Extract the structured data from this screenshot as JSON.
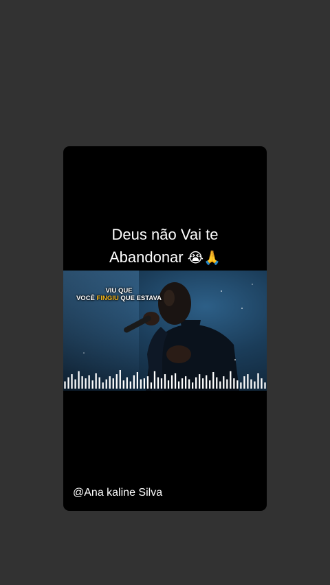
{
  "post": {
    "title_line1": "Deus não Vai te",
    "title_line2": "Abandonar",
    "title_emojis": "😭🙏",
    "caption_line1": "VIU QUE",
    "caption_pre": "VOCÊ ",
    "caption_highlight": "FINGIU",
    "caption_post": " QUE ESTAVA",
    "author_handle": "@Ana kaline Silva"
  },
  "colors": {
    "background": "#323232",
    "card": "#000000",
    "caption_highlight": "#f2b51b"
  },
  "waveform_levels": [
    0.35,
    0.55,
    0.7,
    0.45,
    0.85,
    0.6,
    0.5,
    0.65,
    0.4,
    0.75,
    0.55,
    0.3,
    0.45,
    0.6,
    0.5,
    0.7,
    0.9,
    0.4,
    0.55,
    0.35,
    0.65,
    0.8,
    0.45,
    0.5,
    0.6,
    0.3,
    0.85,
    0.55,
    0.5,
    0.7,
    0.4,
    0.65,
    0.75,
    0.35,
    0.5,
    0.6,
    0.45,
    0.3,
    0.55,
    0.7,
    0.5,
    0.65,
    0.4,
    0.8,
    0.55,
    0.35,
    0.6,
    0.45,
    0.85,
    0.5,
    0.4,
    0.3,
    0.6,
    0.7,
    0.45,
    0.35,
    0.75,
    0.5,
    0.3
  ]
}
